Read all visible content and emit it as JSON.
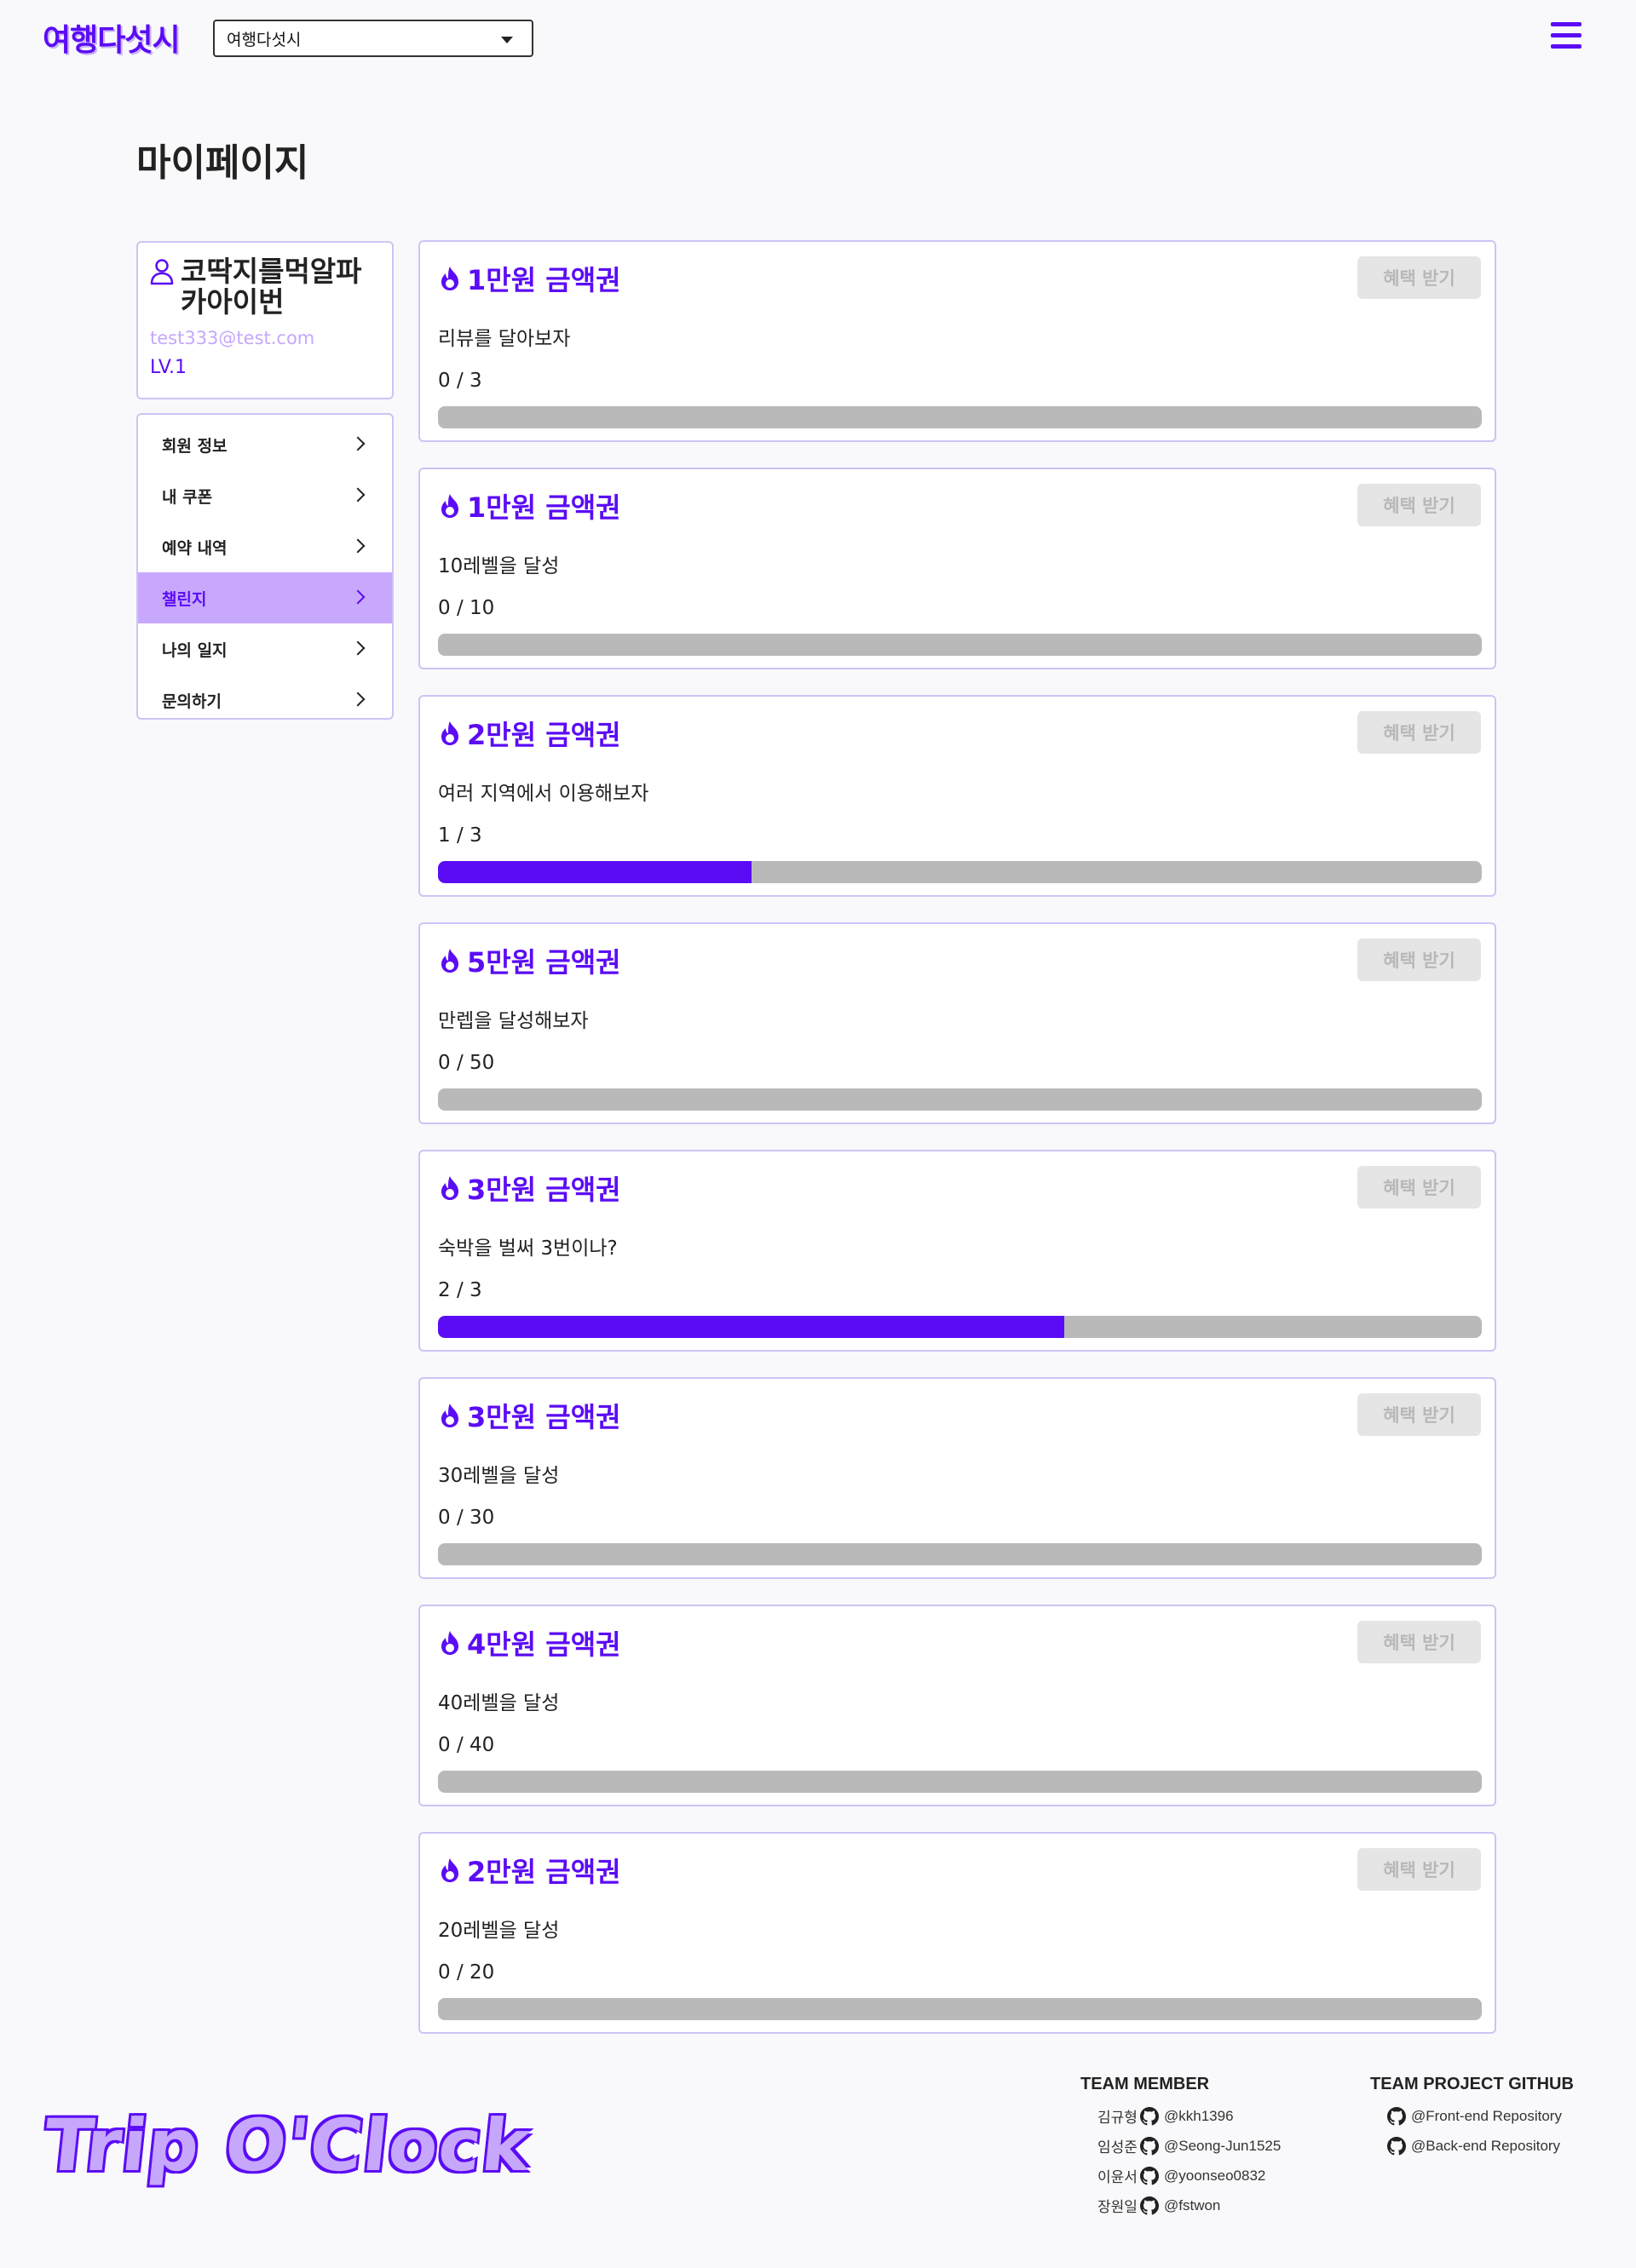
{
  "header": {
    "logo": "여행다섯시",
    "region_select_value": "여행다섯시"
  },
  "page_title": "마이페이지",
  "profile": {
    "name": "코딱지를먹알파카아이번",
    "email": "test333@test.com",
    "level": "LV.1"
  },
  "side_menu": [
    {
      "label": "회원 정보",
      "active": false
    },
    {
      "label": "내 쿠폰",
      "active": false
    },
    {
      "label": "예약 내역",
      "active": false
    },
    {
      "label": "챌린지",
      "active": true
    },
    {
      "label": "나의 일지",
      "active": false
    },
    {
      "label": "문의하기",
      "active": false
    }
  ],
  "benefit_button_label": "혜택 받기",
  "challenges": [
    {
      "title": "1만원 금액권",
      "description": "리뷰를 달아보자",
      "progress_text": "0 / 3",
      "progress": 0.0
    },
    {
      "title": "1만원 금액권",
      "description": "10레벨을 달성",
      "progress_text": "0 / 10",
      "progress": 0.0
    },
    {
      "title": "2만원 금액권",
      "description": "여러 지역에서 이용해보자",
      "progress_text": "1 / 3",
      "progress": 0.3
    },
    {
      "title": "5만원 금액권",
      "description": "만렙을 달성해보자",
      "progress_text": "0 / 50",
      "progress": 0.0
    },
    {
      "title": "3만원 금액권",
      "description": "숙박을 벌써 3번이나?",
      "progress_text": "2 / 3",
      "progress": 0.6
    },
    {
      "title": "3만원 금액권",
      "description": "30레벨을 달성",
      "progress_text": "0 / 30",
      "progress": 0.0
    },
    {
      "title": "4만원 금액권",
      "description": "40레벨을 달성",
      "progress_text": "0 / 40",
      "progress": 0.0
    },
    {
      "title": "2만원 금액권",
      "description": "20레벨을 달성",
      "progress_text": "0 / 20",
      "progress": 0.0
    }
  ],
  "footer": {
    "logo": "Trip O'Clock",
    "team_member_heading": "TEAM MEMBER",
    "members": [
      {
        "name": "김규형",
        "handle": "@kkh1396"
      },
      {
        "name": "임성준",
        "handle": "@Seong-Jun1525"
      },
      {
        "name": "이윤서",
        "handle": "@yoonseo0832"
      },
      {
        "name": "장원일",
        "handle": "@fstwon"
      }
    ],
    "github_heading": "TEAM PROJECT GITHUB",
    "repos": [
      {
        "label": "@Front-end Repository"
      },
      {
        "label": "@Back-end Repository"
      }
    ]
  },
  "colors": {
    "accent": "#5b0cf5",
    "accent_light": "#c8a8fd",
    "border": "#cfc3f4",
    "progress_track": "#b9b9b9"
  }
}
